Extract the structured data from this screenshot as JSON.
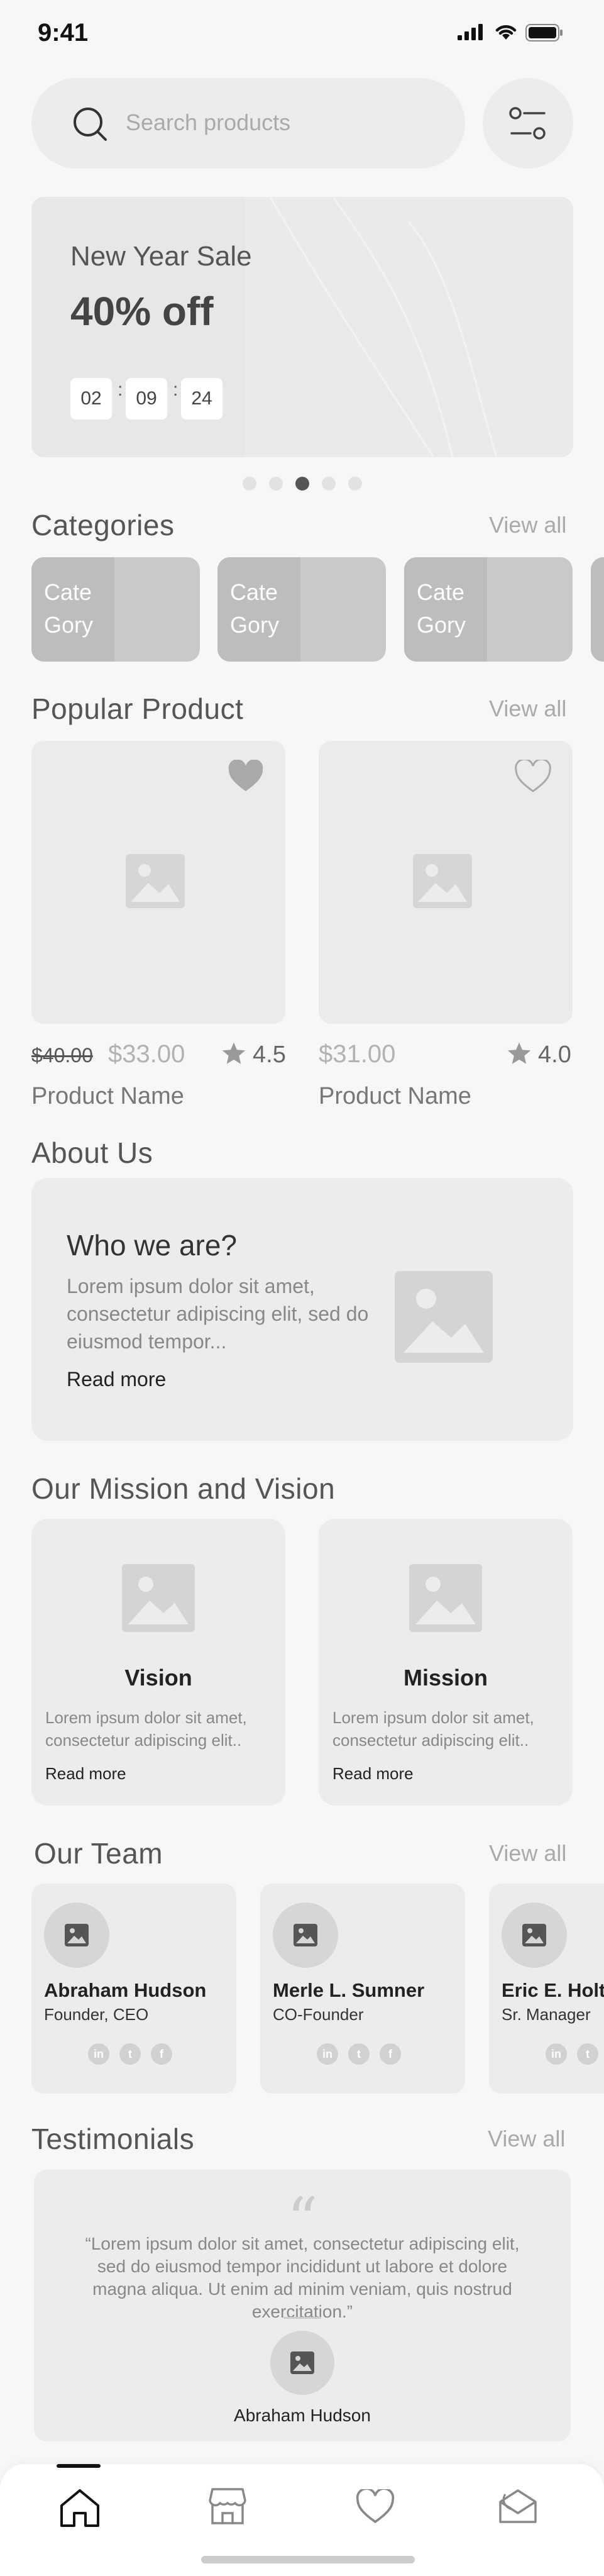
{
  "status_bar": {
    "time": "9:41"
  },
  "search": {
    "placeholder": "Search products"
  },
  "banner": {
    "subtitle": "New Year Sale",
    "title": "40% off",
    "timer": [
      "02",
      "09",
      "24"
    ],
    "timer_separator": ":",
    "slide_count": 5,
    "active_slide": 3
  },
  "categories": {
    "title": "Categories",
    "view_all": "View all",
    "items": [
      {
        "line1": "Cate",
        "line2": "Gory"
      },
      {
        "line1": "Cate",
        "line2": "Gory"
      },
      {
        "line1": "Cate",
        "line2": "Gory"
      }
    ]
  },
  "popular": {
    "title": "Popular Product",
    "view_all": "View all",
    "products": [
      {
        "old_price": "$40.00",
        "price": "$33.00",
        "rating": "4.5",
        "name": "Product Name",
        "favorited": true
      },
      {
        "old_price": "",
        "price": "$31.00",
        "rating": "4.0",
        "name": "Product Name",
        "favorited": false
      }
    ]
  },
  "about": {
    "title": "About Us",
    "heading": "Who we are?",
    "text": "Lorem ipsum dolor sit amet, consectetur adipiscing elit, sed do eiusmod tempor...",
    "link": "Read more"
  },
  "mission": {
    "title": "Our Mission and Vision",
    "cards": [
      {
        "title": "Vision",
        "text": "Lorem ipsum dolor sit amet, consectetur adipiscing elit..",
        "link": "Read more"
      },
      {
        "title": "Mission",
        "text": "Lorem ipsum dolor sit amet, consectetur adipiscing elit..",
        "link": "Read more"
      }
    ]
  },
  "team": {
    "title": "Our Team",
    "view_all": "View all",
    "members": [
      {
        "name": "Abraham Hudson",
        "role": "Founder, CEO"
      },
      {
        "name": "Merle L. Sumner",
        "role": "CO-Founder"
      },
      {
        "name": "Eric E. Holt",
        "role": "Sr. Manager"
      }
    ],
    "socials": [
      "in",
      "t",
      "f"
    ]
  },
  "testimonials": {
    "title": "Testimonials",
    "view_all": "View all",
    "quote": "“Lorem ipsum dolor sit amet, consectetur adipiscing elit, sed do eiusmod tempor incididunt ut labore et dolore magna aliqua. Ut enim ad minim veniam, quis nostrud exercitation.”",
    "author": "Abraham Hudson"
  },
  "bottom_nav": {
    "items": [
      "home-icon",
      "store-icon",
      "heart-icon",
      "contact-icon"
    ],
    "active": "home-icon"
  }
}
